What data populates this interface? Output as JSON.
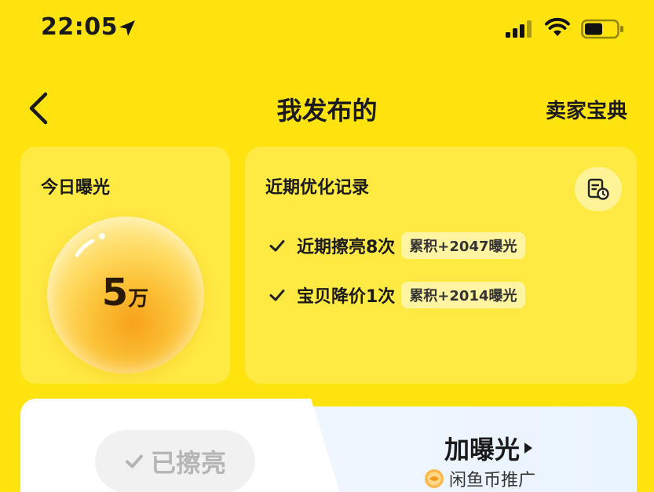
{
  "status_bar": {
    "time": "22:05"
  },
  "nav": {
    "title": "我发布的",
    "right_link": "卖家宝典"
  },
  "exposure": {
    "title": "今日曝光",
    "value": "5",
    "unit": "万"
  },
  "records": {
    "title": "近期优化记录",
    "items": [
      {
        "text": "近期擦亮8次",
        "badge": "累积+2047曝光"
      },
      {
        "text": "宝贝降价1次",
        "badge": "累积+2014曝光"
      }
    ]
  },
  "actions": {
    "polished_label": "已擦亮",
    "boost_label": "加曝光",
    "promo_label": "闲鱼币推广"
  },
  "colors": {
    "background": "#FFE30F",
    "text": "#1a1a1a"
  }
}
